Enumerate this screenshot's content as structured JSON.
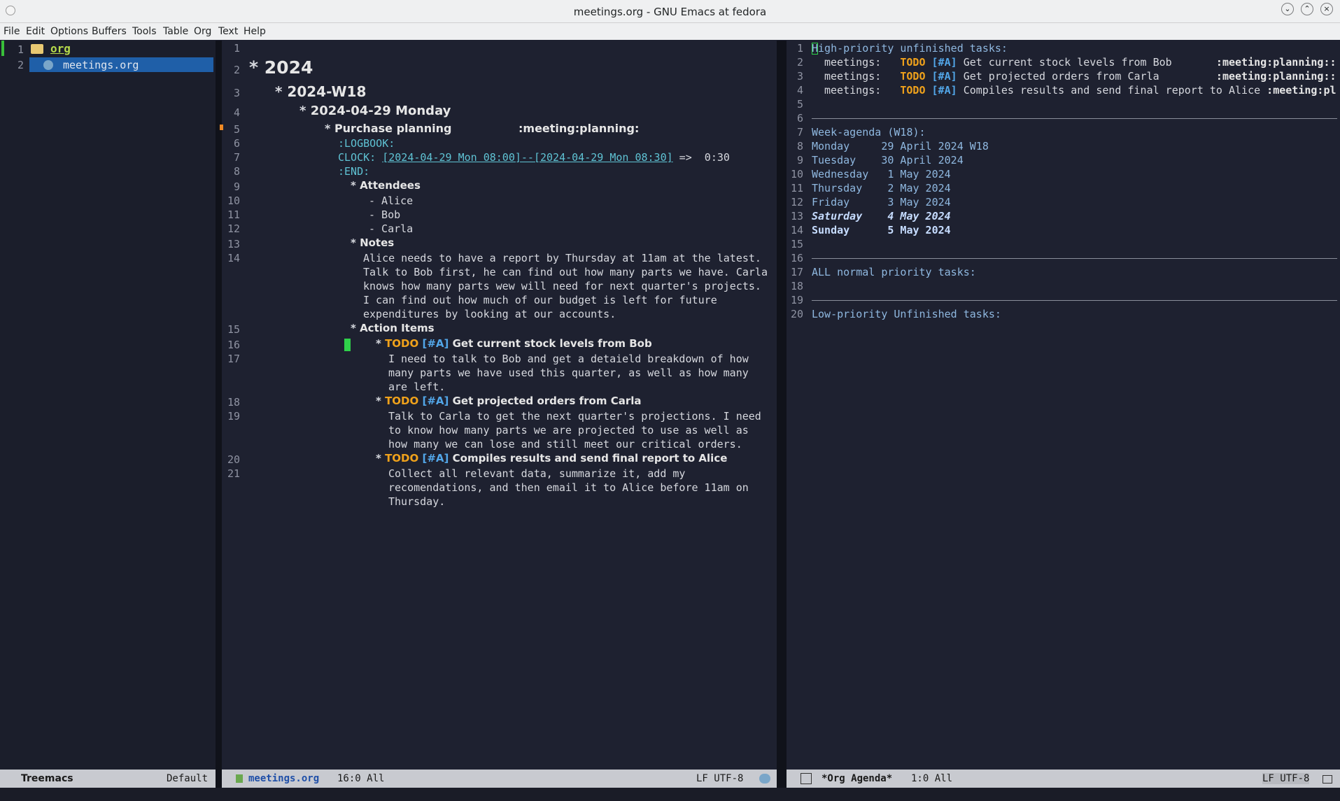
{
  "window": {
    "title": "meetings.org - GNU Emacs at fedora"
  },
  "menu": [
    "File",
    "Edit",
    "Options",
    "Buffers",
    "Tools",
    "Table",
    "Org",
    "Text",
    "Help"
  ],
  "treemacs": {
    "root_label": "org",
    "file_label": "meetings.org",
    "line1": "1",
    "line2": "2",
    "mode_name": "Treemacs",
    "workspace": "Default"
  },
  "editor": {
    "lines": {
      "n1": "1",
      "n2": "2",
      "n3": "3",
      "n4": "4",
      "n5": "5",
      "n6": "6",
      "n7": "7",
      "n8": "8",
      "n9": "9",
      "n10": "10",
      "n11": "11",
      "n12": "12",
      "n13": "13",
      "n14": "14",
      "n15": "15",
      "n16": "16",
      "n17": "17",
      "n18": "18",
      "n19": "19",
      "n20": "20",
      "n21": "21"
    },
    "heading_year": "2024",
    "heading_week": "2024-W18",
    "heading_day": "2024-04-29 Monday",
    "heading_meeting": "Purchase planning",
    "meeting_tags": ":meeting:planning:",
    "logbook": ":LOGBOOK:",
    "clock_label": "CLOCK:",
    "clock_range": "[2024-04-29 Mon 08:00]--[2024-04-29 Mon 08:30]",
    "clock_total": " =>  0:30",
    "end": ":END:",
    "heading_attendees": "Attendees",
    "attendees": [
      "- Alice",
      "- Bob",
      "- Carla"
    ],
    "heading_notes": "Notes",
    "notes": [
      "Alice needs to have a report by Thursday at 11am at the latest.",
      "Talk to Bob first, he can find out how many parts we have. Carla",
      "knows how many parts wew will need for next quarter's projects.",
      "I can find out how much of our budget is left for future",
      "expenditures by looking at our accounts."
    ],
    "heading_actions": "Action Items",
    "todo_keyword": "TODO",
    "priority": "[#A]",
    "task1_title": "Get current stock levels from Bob",
    "task1_body": [
      "I need to talk to Bob and get a detaield breakdown of how",
      "many parts we have used this quarter, as well as how many",
      "are left."
    ],
    "task2_title": "Get projected orders from Carla",
    "task2_body": [
      "Talk to Carla to get the next quarter's projections. I need",
      "to know how many parts we are projected to use as well as",
      "how many we can lose and still meet our critical orders."
    ],
    "task3_title": "Compiles results and send final report to Alice",
    "task3_body": [
      "Collect all relevant data, summarize it, add my",
      "recomendations, and then email it to Alice before 11am on",
      "Thursday."
    ],
    "mode_buffer": "meetings.org",
    "mode_pos": "16:0 All",
    "mode_enc": "LF UTF-8"
  },
  "agenda": {
    "high_header": "High-priority unfinished tasks:",
    "tasks": [
      {
        "category": "meetings:",
        "todo": "TODO",
        "prio": "[#A]",
        "title": "Get current stock levels from Bob      ",
        "tags": ":meeting:planning::"
      },
      {
        "category": "meetings:",
        "todo": "TODO",
        "prio": "[#A]",
        "title": "Get projected orders from Carla        ",
        "tags": ":meeting:planning::"
      },
      {
        "category": "meetings:",
        "todo": "TODO",
        "prio": "[#A]",
        "title": "Compiles results and send final report to Alice",
        "tags": ":meeting:pl"
      }
    ],
    "week_header": "Week-agenda (W18):",
    "days": [
      "Monday     29 April 2024 W18",
      "Tuesday    30 April 2024",
      "Wednesday   1 May 2024",
      "Thursday    2 May 2024",
      "Friday      3 May 2024",
      "Saturday    4 May 2024",
      "Sunday      5 May 2024"
    ],
    "normal_header": "ALL normal priority tasks:",
    "low_header": "Low-priority Unfinished tasks:",
    "mode_buffer": "*Org Agenda*",
    "mode_pos": "1:0 All",
    "mode_enc": "LF UTF-8"
  },
  "colors": {
    "background": "#1e2130",
    "todo": "#f0a21b",
    "priority": "#52a6e8",
    "link": "#5fc3d4",
    "selection": "#1f5fa8"
  }
}
